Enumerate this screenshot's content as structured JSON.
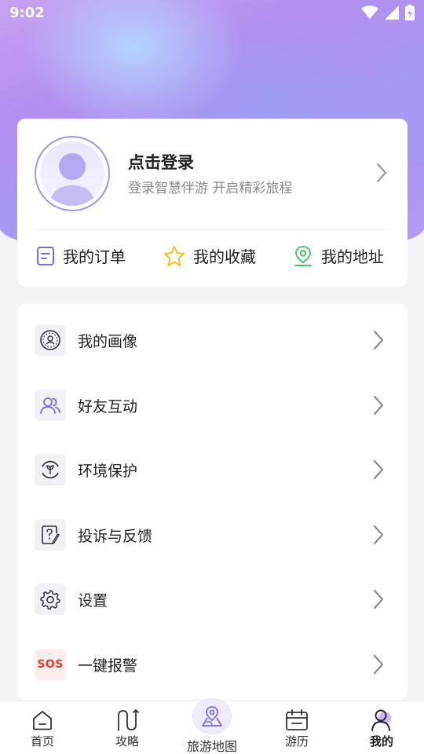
{
  "status_bar": {
    "time": "9:02",
    "icons": [
      "wifi-icon",
      "signal-icon",
      "battery-charging-icon"
    ]
  },
  "profile": {
    "title": "点击登录",
    "subtitle": "登录智慧伴游 开启精彩旅程"
  },
  "quick_links": [
    {
      "label": "我的订单",
      "icon": "order-icon"
    },
    {
      "label": "我的收藏",
      "icon": "star-icon"
    },
    {
      "label": "我的地址",
      "icon": "location-pin-icon"
    }
  ],
  "menu": [
    {
      "label": "我的画像",
      "icon": "portrait-icon"
    },
    {
      "label": "好友互动",
      "icon": "friends-icon"
    },
    {
      "label": "环境保护",
      "icon": "sprout-icon"
    },
    {
      "label": "投诉与反馈",
      "icon": "feedback-icon"
    },
    {
      "label": "设置",
      "icon": "gear-icon"
    },
    {
      "label": "一键报警",
      "icon": "sos-icon",
      "icon_text": "SOS"
    }
  ],
  "tabs": [
    {
      "label": "首页",
      "icon": "home-icon"
    },
    {
      "label": "攻略",
      "icon": "route-icon"
    },
    {
      "label": "旅游地图",
      "icon": "map-icon"
    },
    {
      "label": "游历",
      "icon": "calendar-icon"
    },
    {
      "label": "我的",
      "icon": "user-icon",
      "active": true
    }
  ],
  "colors": {
    "accent_purple": "#7b6ce0",
    "star_yellow": "#f2c21a",
    "location_green": "#4cc26a",
    "sos_red": "#e83a3a"
  }
}
